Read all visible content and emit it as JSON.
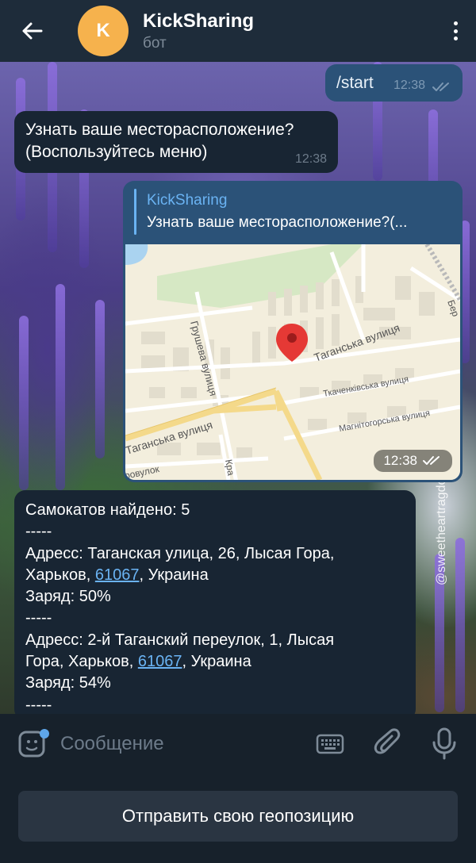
{
  "header": {
    "avatar_letter": "K",
    "title": "KickSharing",
    "subtitle": "бот",
    "avatar_color": "#f6b24d"
  },
  "messages": {
    "start": {
      "text": "/start",
      "time": "12:38"
    },
    "location_prompt": {
      "line1": "Узнать ваше месторасположение?",
      "line2": "(Воспользуйтесь меню)",
      "time": "12:38"
    },
    "map_message": {
      "reply_name": "KickSharing",
      "reply_text": "Узнать ваше месторасположение?(...",
      "time": "12:38",
      "street_labels": {
        "grushevaya": "Грушева вулиця",
        "taganska_right": "Таганська вулиця",
        "taganska_left": "Таганська вулиця",
        "tkachenkivska": "Ткаченківська вулиця",
        "magnitogorska": "Магнітогорська вулиця",
        "provulok": "ровулок",
        "kra": "Кра",
        "ber": "Бер"
      }
    },
    "scooters": {
      "found": "Самокатов найдено: 5",
      "sep": "-----",
      "item1_line1": "Адресс: Таганская улица, 26, Лысая Гора,",
      "item1_city": "Харьков, ",
      "item1_zip": "61067",
      "item1_country": ", Украина",
      "item1_charge": "Заряд: 50%",
      "item2_line1": "Адресс: 2-й Таганский переулок, 1, Лысая",
      "item2_city": "Гора, Харьков, ",
      "item2_zip": "61067",
      "item2_country": ", Украина",
      "item2_charge": "Заряд: 54%"
    }
  },
  "watermark": "@sweetheartragdoll",
  "input": {
    "placeholder": "Сообщение"
  },
  "keyboard": {
    "geo_button": "Отправить свою геопозицию"
  },
  "colors": {
    "header_bg": "#1e2c3a",
    "bubble_out": "#2b5278",
    "bubble_in": "#182533",
    "link": "#6ab3f3"
  }
}
